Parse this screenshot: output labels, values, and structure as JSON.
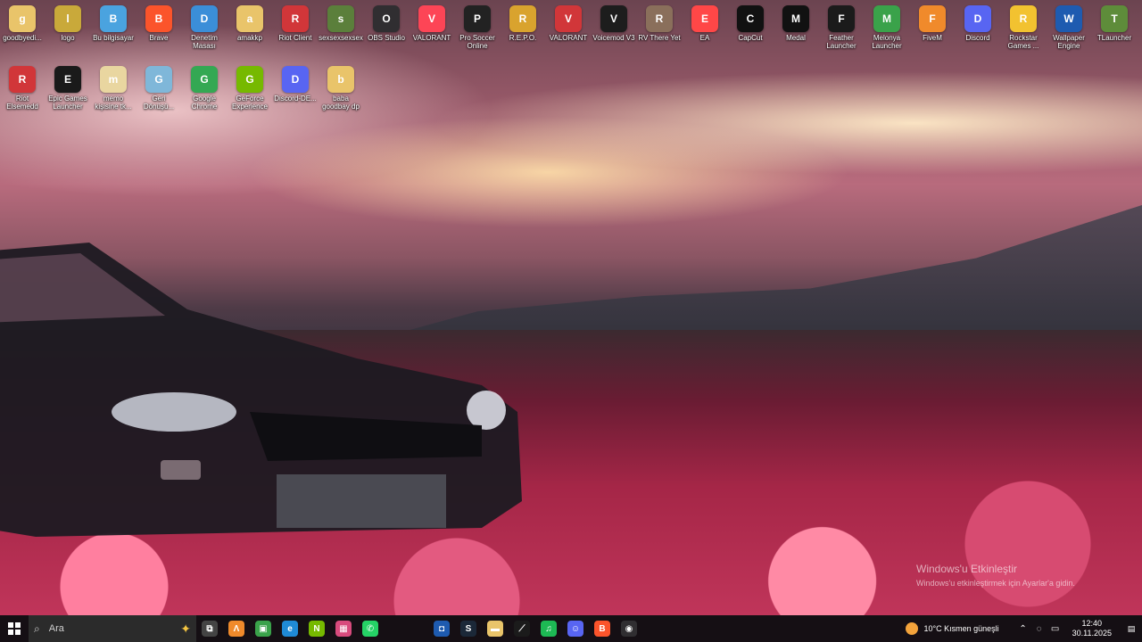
{
  "desktop": {
    "row1": [
      {
        "label": "goodbyedi...",
        "icon": "folder-icon",
        "color": "#e9c46a"
      },
      {
        "label": "logo",
        "icon": "image-icon",
        "color": "#c9a93a"
      },
      {
        "label": "Bu bilgisayar",
        "icon": "computer-icon",
        "color": "#4aa3df"
      },
      {
        "label": "Brave",
        "icon": "brave-icon",
        "color": "#fb542b"
      },
      {
        "label": "Denetim Masası",
        "icon": "control-panel-icon",
        "color": "#3b8ed8"
      },
      {
        "label": "amakkp",
        "icon": "folder-icon",
        "color": "#e9c46a"
      },
      {
        "label": "Riot Client",
        "icon": "riot-icon",
        "color": "#d13639"
      },
      {
        "label": "sexsexsexsex",
        "icon": "gta-icon",
        "color": "#5b7f3b"
      },
      {
        "label": "OBS Studio",
        "icon": "obs-icon",
        "color": "#302e31"
      },
      {
        "label": "VALORANT",
        "icon": "valorant-icon",
        "color": "#fd4556"
      },
      {
        "label": "Pro Soccer Online",
        "icon": "soccer-icon",
        "color": "#222"
      },
      {
        "label": "R.E.P.O.",
        "icon": "repo-icon",
        "color": "#d9a32e"
      },
      {
        "label": "VALORANT",
        "icon": "riot-icon",
        "color": "#d13639"
      },
      {
        "label": "Voicemod V3",
        "icon": "voicemod-icon",
        "color": "#1d1d1d"
      },
      {
        "label": "RV There Yet",
        "icon": "rv-icon",
        "color": "#8a6f5b"
      },
      {
        "label": "EA",
        "icon": "ea-icon",
        "color": "#ff4747"
      },
      {
        "label": "CapCut",
        "icon": "capcut-icon",
        "color": "#111"
      },
      {
        "label": "Medal",
        "icon": "medal-icon",
        "color": "#111"
      },
      {
        "label": "Feather Launcher",
        "icon": "feather-icon",
        "color": "#1b1b1b"
      },
      {
        "label": "Melonya Launcher",
        "icon": "melonya-icon",
        "color": "#3aa24a"
      },
      {
        "label": "FiveM",
        "icon": "fivem-icon",
        "color": "#f08a2b"
      },
      {
        "label": "Discord",
        "icon": "discord-icon",
        "color": "#5865f2"
      },
      {
        "label": "Rockstar Games ...",
        "icon": "rockstar-icon",
        "color": "#f2c230"
      },
      {
        "label": "Wallpaper Engine",
        "icon": "wallpaper-engine-icon",
        "color": "#1e5bb0"
      },
      {
        "label": "TLauncher",
        "icon": "minecraft-icon",
        "color": "#5e8c3a"
      }
    ],
    "row2": [
      {
        "label": "Riot Elsemedd",
        "icon": "riot-icon",
        "color": "#d13639"
      },
      {
        "label": "Epic Games Launcher",
        "icon": "epic-icon",
        "color": "#1a1a1a"
      },
      {
        "label": "memo kişisine tk...",
        "icon": "document-icon",
        "color": "#e9d6a0"
      },
      {
        "label": "Geri Dönüşü...",
        "icon": "recycle-bin-icon",
        "color": "#7fb7d9"
      },
      {
        "label": "Google Chrome",
        "icon": "chrome-icon",
        "color": "#34a853"
      },
      {
        "label": "GeForce Experience",
        "icon": "nvidia-icon",
        "color": "#76b900"
      },
      {
        "label": "Discord-DE...",
        "icon": "discord-icon",
        "color": "#5865f2"
      },
      {
        "label": "baba goodbay dp",
        "icon": "folder-icon",
        "color": "#e9c46a"
      }
    ]
  },
  "activation": {
    "title": "Windows'u Etkinleştir",
    "subtitle": "Windows'u etkinleştirmek için Ayarlar'a gidin."
  },
  "taskbar": {
    "search_placeholder": "Ara",
    "apps": [
      {
        "name": "task-view-icon",
        "glyph": "⧉",
        "color": "#444"
      },
      {
        "name": "fivem-icon",
        "glyph": "Λ",
        "color": "#f08a2b"
      },
      {
        "name": "melonya-icon",
        "glyph": "▣",
        "color": "#3aa24a"
      },
      {
        "name": "edge-icon",
        "glyph": "e",
        "color": "#1f8ad6"
      },
      {
        "name": "nvidia-icon",
        "glyph": "N",
        "color": "#76b900"
      },
      {
        "name": "store-icon",
        "glyph": "▦",
        "color": "#d84b7d"
      },
      {
        "name": "whatsapp-icon",
        "glyph": "✆",
        "color": "#25d366"
      },
      {
        "name": "spacer",
        "glyph": "",
        "color": "transparent"
      },
      {
        "name": "app-icon",
        "glyph": "◘",
        "color": "#1e5bb0"
      },
      {
        "name": "steam-icon",
        "glyph": "S",
        "color": "#1b2838"
      },
      {
        "name": "file-explorer-icon",
        "glyph": "▬",
        "color": "#e9c46a"
      },
      {
        "name": "feather-icon",
        "glyph": "⟋",
        "color": "#1b1b1b"
      },
      {
        "name": "spotify-icon",
        "glyph": "♫",
        "color": "#1db954"
      },
      {
        "name": "discord-icon",
        "glyph": "☺",
        "color": "#5865f2"
      },
      {
        "name": "brave-icon",
        "glyph": "B",
        "color": "#fb542b"
      },
      {
        "name": "obs-icon",
        "glyph": "◉",
        "color": "#302e31"
      }
    ],
    "weather": "10°C  Kısmen güneşli",
    "time": "12:40",
    "date": "30.11.2025"
  }
}
